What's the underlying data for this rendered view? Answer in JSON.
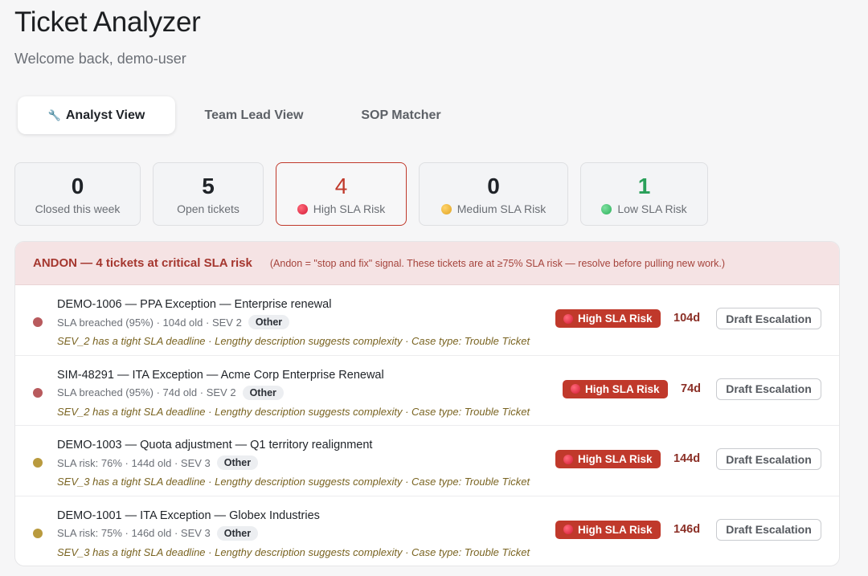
{
  "header": {
    "title": "Ticket Analyzer",
    "subtitle": "Welcome back, demo-user"
  },
  "tabs": [
    {
      "label": "Analyst View",
      "icon": "wrench-icon",
      "active": true
    },
    {
      "label": "Team Lead View",
      "active": false
    },
    {
      "label": "SOP Matcher",
      "active": false
    }
  ],
  "stats": [
    {
      "value": "0",
      "label": "Closed this week"
    },
    {
      "value": "5",
      "label": "Open tickets"
    },
    {
      "value": "4",
      "label": "High SLA Risk",
      "icon": "red-circle-icon",
      "color": "#c0392b"
    },
    {
      "value": "0",
      "label": "Medium SLA Risk",
      "icon": "yellow-circle-icon"
    },
    {
      "value": "1",
      "label": "Low SLA Risk",
      "icon": "green-circle-icon",
      "color": "#2aa05a"
    }
  ],
  "andon": {
    "title": "ANDON — 4 tickets at critical SLA risk",
    "note": "(Andon = \"stop and fix\" signal. These tickets are at ≥75% SLA risk — resolve before pulling new work.)",
    "rows": [
      {
        "title": "DEMO-1006 — PPA Exception — Enterprise renewal",
        "meta": "SLA breached (95%) · 104d old · SEV 2",
        "tag": "Other",
        "reason": "SEV_2 has a tight SLA deadline · Lengthy description suggests complexity · Case type: Trouble Ticket",
        "risk": "High SLA Risk",
        "age": "104d",
        "action": "Draft Escalation",
        "dot_color": "#b85a5d"
      },
      {
        "title": "SIM-48291 — ITA Exception — Acme Corp Enterprise Renewal",
        "meta": "SLA breached (95%) · 74d old · SEV 2",
        "tag": "Other",
        "reason": "SEV_2 has a tight SLA deadline · Lengthy description suggests complexity · Case type: Trouble Ticket",
        "risk": "High SLA Risk",
        "age": "74d",
        "action": "Draft Escalation",
        "dot_color": "#b85a5d"
      },
      {
        "title": "DEMO-1003 — Quota adjustment — Q1 territory realignment",
        "meta": "SLA risk: 76% · 144d old · SEV 3",
        "tag": "Other",
        "reason": "SEV_3 has a tight SLA deadline · Lengthy description suggests complexity · Case type: Trouble Ticket",
        "risk": "High SLA Risk",
        "age": "144d",
        "action": "Draft Escalation",
        "dot_color": "#b99a3e"
      },
      {
        "title": "DEMO-1001 — ITA Exception — Globex Industries",
        "meta": "SLA risk: 75% · 146d old · SEV 3",
        "tag": "Other",
        "reason": "SEV_3 has a tight SLA deadline · Lengthy description suggests complexity · Case type: Trouble Ticket",
        "risk": "High SLA Risk",
        "age": "146d",
        "action": "Draft Escalation",
        "dot_color": "#b99a3e"
      }
    ]
  }
}
